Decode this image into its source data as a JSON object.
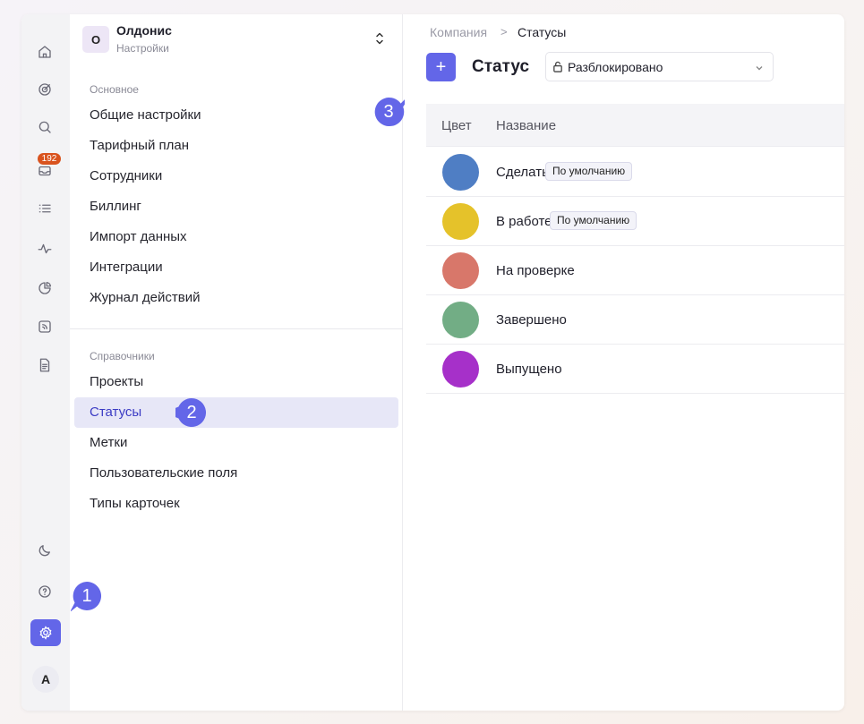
{
  "colors": {
    "accent": "#6366e8",
    "active_bg": "#e7e7f7",
    "badge": "#d9531e"
  },
  "rail": {
    "icons": [
      "home-icon",
      "target-icon",
      "search-icon",
      "inbox-icon",
      "list-icon",
      "activity-icon",
      "pie-chart-icon",
      "feed-icon",
      "document-icon",
      "moon-icon",
      "help-icon",
      "settings-icon"
    ],
    "inbox_badge": "192",
    "avatar": "A"
  },
  "org": {
    "initial": "О",
    "name": "Олдонис",
    "subtitle": "Настройки",
    "switch_symbol": "⌃⌄"
  },
  "sidebar": {
    "main_section": {
      "title": "Основное",
      "items": [
        "Общие настройки",
        "Тарифный план",
        "Сотрудники",
        "Биллинг",
        "Импорт данных",
        "Интеграции",
        "Журнал действий"
      ]
    },
    "reference_section": {
      "title": "Справочники",
      "items": [
        "Проекты",
        "Статусы",
        "Метки",
        "Пользовательские поля",
        "Типы карточек"
      ]
    },
    "active_item": "Статусы"
  },
  "breadcrumb": {
    "parent": "Компания",
    "separator": ">",
    "current": "Статусы"
  },
  "header": {
    "add_label": "+",
    "title": "Статус",
    "lock_select": {
      "value": "Разблокировано"
    }
  },
  "table": {
    "headers": {
      "color": "Цвет",
      "name": "Название"
    },
    "rows": [
      {
        "name": "Сделать",
        "color": "#4f7ec4",
        "tag": "По умолчанию"
      },
      {
        "name": "В работе",
        "color": "#e5c22a",
        "tag": "По умолчанию"
      },
      {
        "name": "На проверке",
        "color": "#d8776a",
        "tag": ""
      },
      {
        "name": "Завершено",
        "color": "#72ad85",
        "tag": ""
      },
      {
        "name": "Выпущено",
        "color": "#a630c9",
        "tag": ""
      }
    ]
  },
  "callouts": [
    "1",
    "2",
    "3"
  ]
}
